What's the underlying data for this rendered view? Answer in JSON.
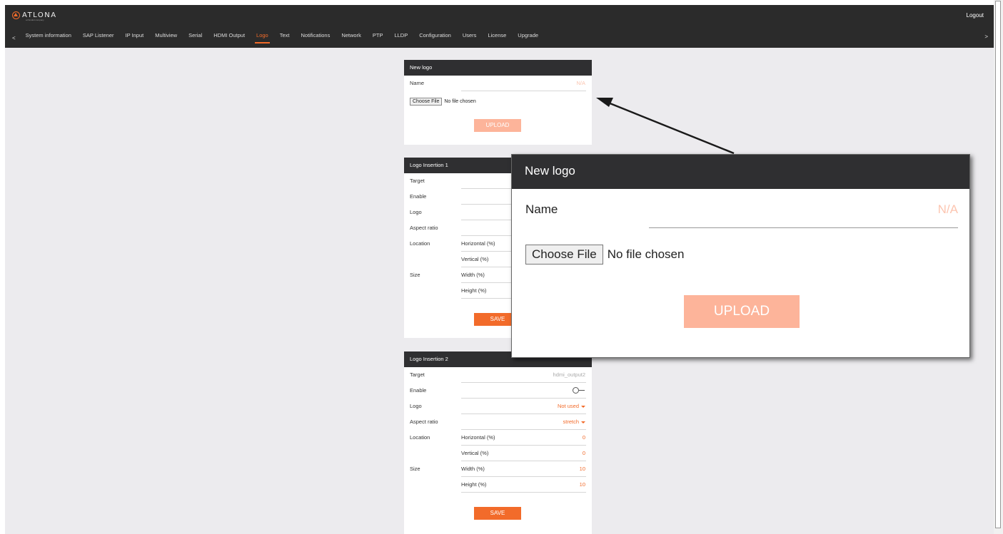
{
  "header": {
    "brand": "ATLONA",
    "brand_sub": "a Panduit company",
    "logout": "Logout",
    "nav_prev": "<",
    "nav_next": ">",
    "nav": [
      "System information",
      "SAP Listener",
      "IP Input",
      "Multiview",
      "Serial",
      "HDMI Output",
      "Logo",
      "Text",
      "Notifications",
      "Network",
      "PTP",
      "LLDP",
      "Configuration",
      "Users",
      "License",
      "Upgrade"
    ],
    "active_tab": "Logo"
  },
  "new_logo": {
    "title": "New logo",
    "name_label": "Name",
    "name_value": "N/A",
    "choose_file": "Choose File",
    "no_file": "No file chosen",
    "upload": "UPLOAD"
  },
  "insertion1": {
    "title": "Logo Insertion 1",
    "target_label": "Target",
    "enable_label": "Enable",
    "logo_label": "Logo",
    "aspect_label": "Aspect ratio",
    "location_label": "Location",
    "horizontal_label": "Horizontal (%)",
    "vertical_label": "Vertical (%)",
    "size_label": "Size",
    "width_label": "Width (%)",
    "height_label": "Height (%)",
    "save": "SAVE"
  },
  "insertion2": {
    "title": "Logo Insertion 2",
    "target_label": "Target",
    "target_value": "hdmi_output2",
    "enable_label": "Enable",
    "logo_label": "Logo",
    "logo_value": "Not used",
    "aspect_label": "Aspect ratio",
    "aspect_value": "stretch",
    "location_label": "Location",
    "horizontal_label": "Horizontal (%)",
    "horizontal_value": "0",
    "vertical_label": "Vertical (%)",
    "vertical_value": "0",
    "size_label": "Size",
    "width_label": "Width (%)",
    "width_value": "10",
    "height_label": "Height (%)",
    "height_value": "10",
    "save": "SAVE"
  },
  "colors": {
    "accent": "#f26b2a",
    "header_bg": "#2b2b2b",
    "page_bg": "#ecebee"
  }
}
